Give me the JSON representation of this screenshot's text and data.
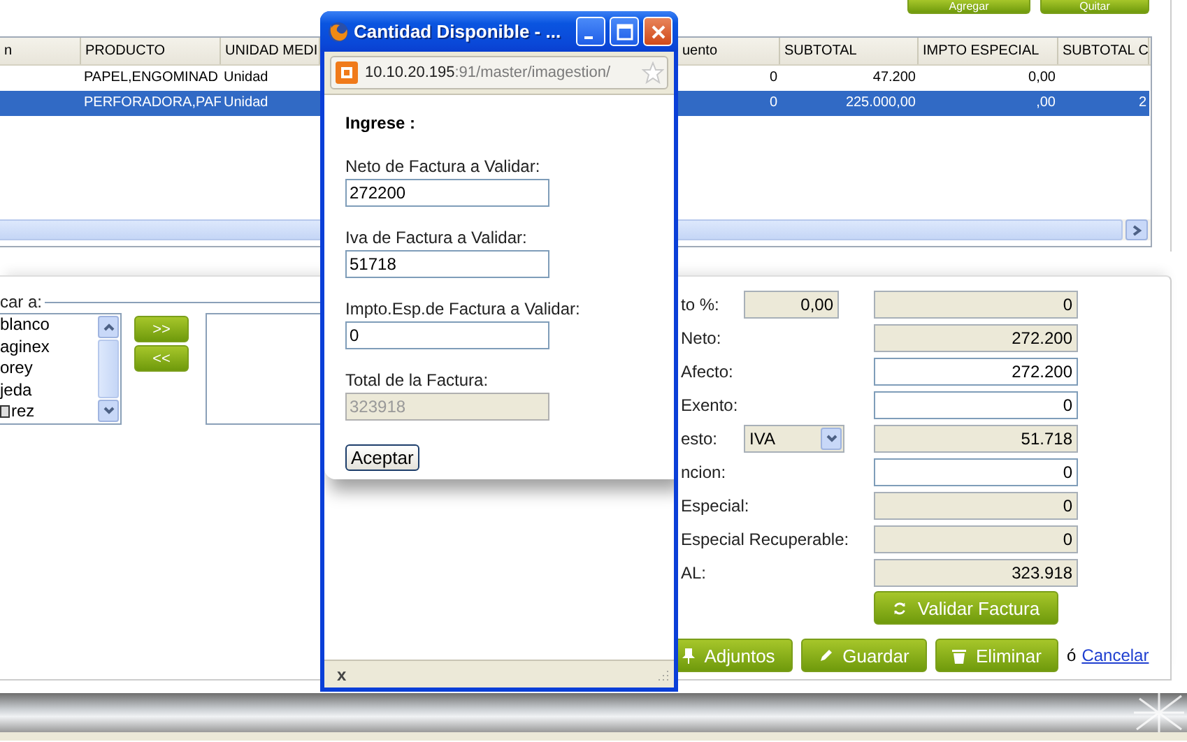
{
  "toolbar": {
    "buttons": [
      "Agregar",
      "Quitar"
    ]
  },
  "table": {
    "columns": [
      "n",
      "PRODUCTO",
      "UNIDAD MEDI",
      "uento",
      "SUBTOTAL",
      "IMPTO ESPECIAL",
      "SUBTOTAL C"
    ],
    "rows": [
      {
        "selected": false,
        "cells": [
          "",
          "PAPEL,ENGOMINAD",
          "Unidad",
          "0",
          "47.200",
          "0,00"
        ]
      },
      {
        "selected": true,
        "cells": [
          "",
          "PERFORADORA,PAF",
          "Unidad",
          "0",
          "225.000,00",
          ",00",
          "2"
        ]
      }
    ]
  },
  "assign": {
    "legend": "car a:",
    "available": [
      "blanco",
      "aginex",
      "orey",
      "jeda",
      "rez"
    ],
    "add_button": ">>",
    "remove_button": "<<"
  },
  "totals": [
    {
      "kind": "percent",
      "label": "to %:",
      "percent": "0,00",
      "value": "0",
      "readonly": true
    },
    {
      "kind": "plain",
      "label": "Neto:",
      "value": "272.200",
      "readonly": true
    },
    {
      "kind": "plain",
      "label": "Afecto:",
      "value": "272.200",
      "readonly": false
    },
    {
      "kind": "plain",
      "label": "Exento:",
      "value": "0",
      "readonly": false
    },
    {
      "kind": "select",
      "label": "esto:",
      "option": "IVA",
      "value": "51.718",
      "readonly": true
    },
    {
      "kind": "plain",
      "label": "ncion:",
      "value": "0",
      "readonly": false
    },
    {
      "kind": "plain",
      "label": "Especial:",
      "value": "0",
      "readonly": true
    },
    {
      "kind": "plain",
      "label": "Especial Recuperable:",
      "value": "0",
      "readonly": true
    },
    {
      "kind": "plain",
      "label": "AL:",
      "value": "323.918",
      "readonly": true
    }
  ],
  "validate_button": "Validar Factura",
  "actions": {
    "buttons": [
      "Adjuntos",
      "Guardar",
      "Eliminar"
    ],
    "separator": "ó",
    "cancel_link": "Cancelar"
  },
  "popup": {
    "title": "Cantidad Disponible - ...",
    "url_host": "10.10.20.195",
    "url_path": ":91/master/imagestion/",
    "heading": "Ingrese :",
    "fields": [
      {
        "label": "Neto de Factura a Validar:",
        "value": "272200",
        "disabled": false
      },
      {
        "label": "Iva de Factura a Validar:",
        "value": "51718",
        "disabled": false
      },
      {
        "label": "Impto.Esp.de Factura a Validar:",
        "value": "0",
        "disabled": false
      },
      {
        "label": "Total de la Factura:",
        "value": "323918",
        "disabled": true
      }
    ],
    "button": "Aceptar",
    "status_close": "x"
  }
}
